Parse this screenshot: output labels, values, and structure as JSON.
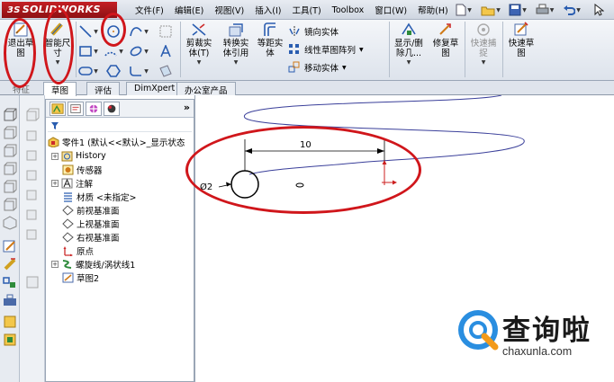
{
  "app": {
    "logo_prefix": "3S",
    "logo_name": "SOLIDWORKS"
  },
  "menu": [
    "文件(F)",
    "编辑(E)",
    "视图(V)",
    "插入(I)",
    "工具(T)",
    "Toolbox",
    "窗口(W)",
    "帮助(H)"
  ],
  "ribbon": {
    "exit_sketch": "退出草\n图",
    "smart_dimension": "智能尺\n寸",
    "trim_entities": "剪裁实\n体(T)",
    "convert_entities": "转换实\n体引用",
    "offset_entities": "等距实\n体",
    "mirror_entities": "镜向实体",
    "linear_pattern": "线性草图阵列",
    "move_entities": "移动实体",
    "display_delete_relations": "显示/删\n除几...",
    "repair_sketch": "修复草\n图",
    "quick_snaps": "快速捕\n捉",
    "rapid_sketch": "快速草\n图"
  },
  "tabs": [
    "草图",
    "评估",
    "DimXpert",
    "办公室产品"
  ],
  "tabs_hidden_first": "特征",
  "panel": {
    "collapse_glyph": "»"
  },
  "tree": {
    "root": "零件1 (默认<<默认>_显示状态",
    "items": [
      {
        "label": "History",
        "expander": "+"
      },
      {
        "label": "传感器",
        "expander": ""
      },
      {
        "label": "注解",
        "expander": "+"
      },
      {
        "label": "材质 <未指定>",
        "expander": ""
      },
      {
        "label": "前视基准面",
        "expander": ""
      },
      {
        "label": "上视基准面",
        "expander": ""
      },
      {
        "label": "右视基准面",
        "expander": ""
      },
      {
        "label": "原点",
        "expander": ""
      },
      {
        "label": "螺旋线/涡状线1",
        "expander": "+"
      },
      {
        "label": "草图2",
        "expander": ""
      }
    ]
  },
  "canvas": {
    "dimension_length": "10",
    "dimension_diameter": "Ø2"
  },
  "watermark": {
    "text": "查询啦",
    "url": "chaxunla.com"
  },
  "colors": {
    "annotation": "#d0161b",
    "helix": "#3a3f9a",
    "dimension": "#000000",
    "origin": "#cc1f1f"
  }
}
